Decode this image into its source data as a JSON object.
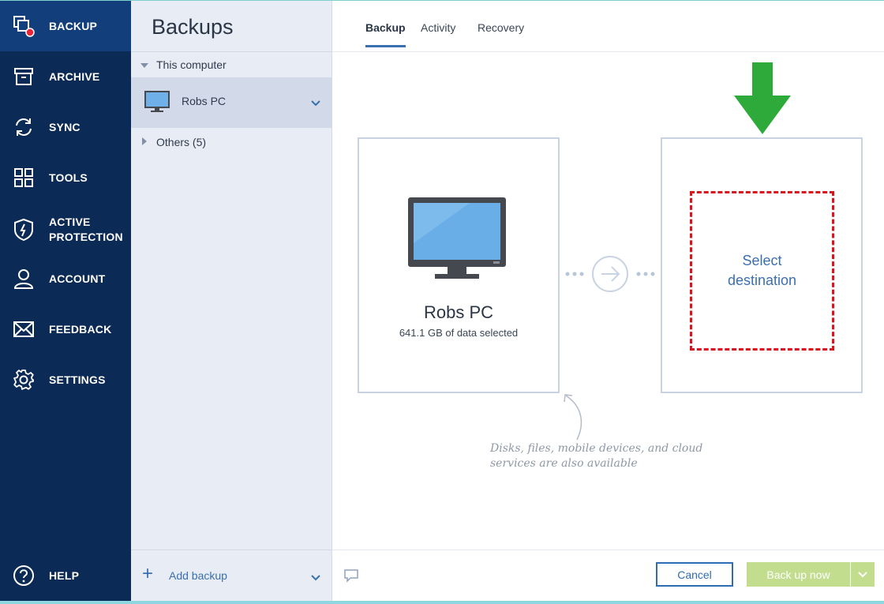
{
  "nav": {
    "items": [
      {
        "label": "BACKUP",
        "icon": "backup-icon"
      },
      {
        "label": "ARCHIVE",
        "icon": "archive-icon"
      },
      {
        "label": "SYNC",
        "icon": "sync-icon"
      },
      {
        "label": "TOOLS",
        "icon": "tools-icon"
      },
      {
        "label": "ACTIVE\nPROTECTION",
        "icon": "shield-icon"
      },
      {
        "label": "ACCOUNT",
        "icon": "account-icon"
      },
      {
        "label": "FEEDBACK",
        "icon": "envelope-icon"
      },
      {
        "label": "SETTINGS",
        "icon": "gear-icon"
      }
    ],
    "help": {
      "label": "HELP",
      "icon": "help-icon"
    }
  },
  "sidebar": {
    "title": "Backups",
    "group_label": "This computer",
    "selected_item": "Robs PC",
    "others_label": "Others (5)",
    "add_backup_label": "Add backup"
  },
  "tabs": [
    "Backup",
    "Activity",
    "Recovery"
  ],
  "source": {
    "name": "Robs PC",
    "size_text": "641.1 GB of data selected"
  },
  "destination": {
    "label": "Select\ndestination"
  },
  "hint_text": "Disks, files, mobile devices, and cloud\nservices are also available",
  "buttons": {
    "cancel": "Cancel",
    "back_up_now": "Back up now"
  },
  "colors": {
    "nav_bg": "#0b2a55",
    "nav_active": "#123e7c",
    "accent": "#3a6fb0",
    "highlight_green": "#2eaa3a",
    "dashed_red": "#d9141c",
    "backup_button": "#c2dd8d"
  }
}
